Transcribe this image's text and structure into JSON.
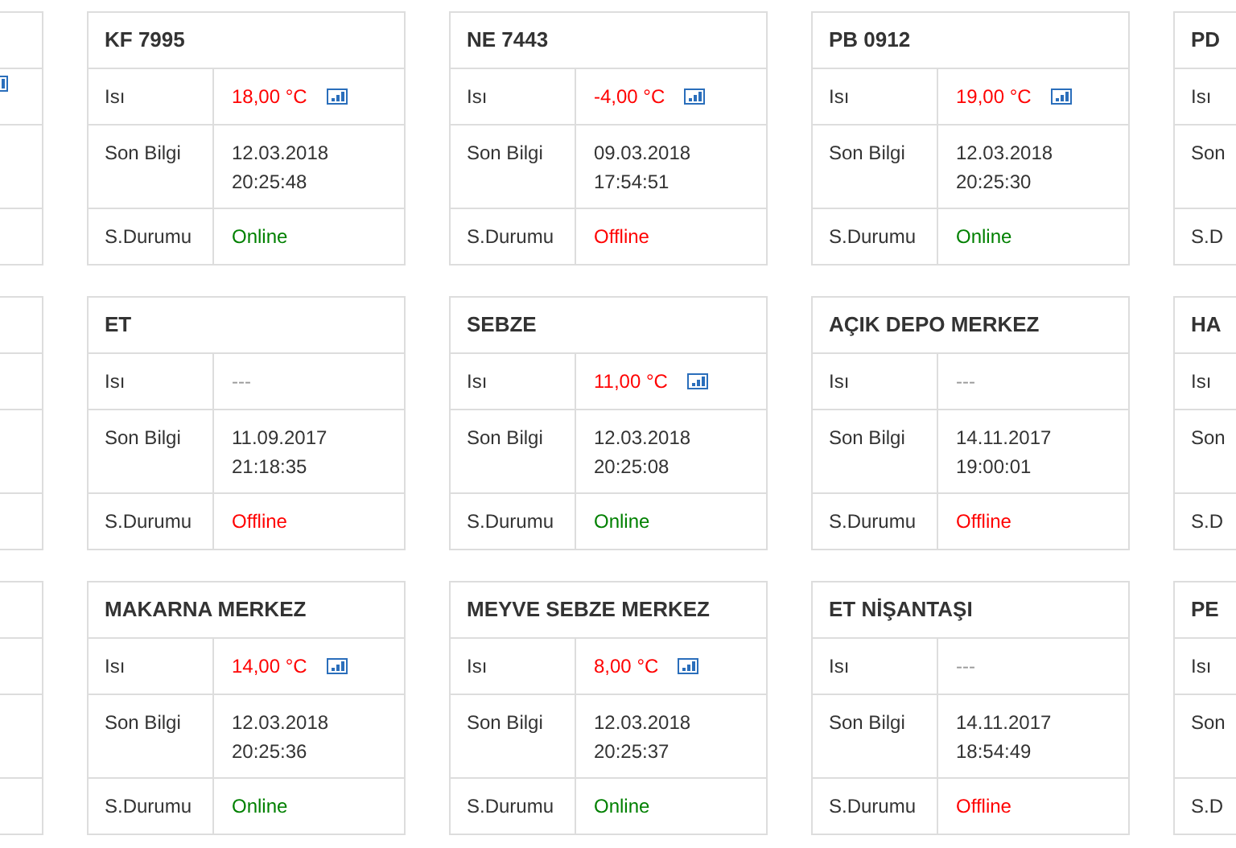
{
  "rows": [
    {
      "cards": [
        {
          "kind": "clipped_left",
          "chart_icon": true
        },
        {
          "kind": "full",
          "title": "KF 7995",
          "fields": [
            {
              "label": "Isı",
              "lines": [
                "18,00 °C"
              ],
              "color": "#ff0000",
              "chart_icon": true
            },
            {
              "label": "Son Bilgi",
              "lines": [
                "12.03.2018",
                "20:25:48"
              ],
              "color": "#333333"
            },
            {
              "label": "S.Durumu",
              "lines": [
                "Online"
              ],
              "color": "#008000"
            }
          ]
        },
        {
          "kind": "full",
          "title": "NE 7443",
          "fields": [
            {
              "label": "Isı",
              "lines": [
                "-4,00 °C"
              ],
              "color": "#ff0000",
              "chart_icon": true
            },
            {
              "label": "Son Bilgi",
              "lines": [
                "09.03.2018",
                "17:54:51"
              ],
              "color": "#333333"
            },
            {
              "label": "S.Durumu",
              "lines": [
                "Offline"
              ],
              "color": "#ff0000"
            }
          ]
        },
        {
          "kind": "full",
          "title": "PB 0912",
          "fields": [
            {
              "label": "Isı",
              "lines": [
                "19,00 °C"
              ],
              "color": "#ff0000",
              "chart_icon": true
            },
            {
              "label": "Son Bilgi",
              "lines": [
                "12.03.2018",
                "20:25:30"
              ],
              "color": "#333333"
            },
            {
              "label": "S.Durumu",
              "lines": [
                "Online"
              ],
              "color": "#008000"
            }
          ]
        },
        {
          "kind": "clipped_right",
          "title": "PD",
          "labels": [
            "Isı",
            "Son",
            "S.D"
          ]
        }
      ]
    },
    {
      "cards": [
        {
          "kind": "clipped_left",
          "chart_icon": false
        },
        {
          "kind": "full",
          "title": "ET",
          "fields": [
            {
              "label": "Isı",
              "lines": [
                "---"
              ],
              "color": "#999999",
              "chart_icon": false
            },
            {
              "label": "Son Bilgi",
              "lines": [
                "11.09.2017",
                "21:18:35"
              ],
              "color": "#333333"
            },
            {
              "label": "S.Durumu",
              "lines": [
                "Offline"
              ],
              "color": "#ff0000"
            }
          ]
        },
        {
          "kind": "full",
          "title": "SEBZE",
          "fields": [
            {
              "label": "Isı",
              "lines": [
                "11,00 °C"
              ],
              "color": "#ff0000",
              "chart_icon": true
            },
            {
              "label": "Son Bilgi",
              "lines": [
                "12.03.2018",
                "20:25:08"
              ],
              "color": "#333333"
            },
            {
              "label": "S.Durumu",
              "lines": [
                "Online"
              ],
              "color": "#008000"
            }
          ]
        },
        {
          "kind": "full",
          "title": "AÇIK DEPO MERKEZ",
          "fields": [
            {
              "label": "Isı",
              "lines": [
                "---"
              ],
              "color": "#999999",
              "chart_icon": false
            },
            {
              "label": "Son Bilgi",
              "lines": [
                "14.11.2017",
                "19:00:01"
              ],
              "color": "#333333"
            },
            {
              "label": "S.Durumu",
              "lines": [
                "Offline"
              ],
              "color": "#ff0000"
            }
          ]
        },
        {
          "kind": "clipped_right",
          "title": "HA",
          "labels": [
            "Isı",
            "Son",
            "S.D"
          ]
        }
      ]
    },
    {
      "cards": [
        {
          "kind": "clipped_left",
          "chart_icon": false
        },
        {
          "kind": "full",
          "title": "MAKARNA MERKEZ",
          "fields": [
            {
              "label": "Isı",
              "lines": [
                "14,00 °C"
              ],
              "color": "#ff0000",
              "chart_icon": true
            },
            {
              "label": "Son Bilgi",
              "lines": [
                "12.03.2018",
                "20:25:36"
              ],
              "color": "#333333"
            },
            {
              "label": "S.Durumu",
              "lines": [
                "Online"
              ],
              "color": "#008000"
            }
          ]
        },
        {
          "kind": "full",
          "title": "MEYVE SEBZE MERKEZ",
          "fields": [
            {
              "label": "Isı",
              "lines": [
                "8,00 °C"
              ],
              "color": "#ff0000",
              "chart_icon": true
            },
            {
              "label": "Son Bilgi",
              "lines": [
                "12.03.2018",
                "20:25:37"
              ],
              "color": "#333333"
            },
            {
              "label": "S.Durumu",
              "lines": [
                "Online"
              ],
              "color": "#008000"
            }
          ]
        },
        {
          "kind": "full",
          "title": "ET NİŞANTAŞI",
          "fields": [
            {
              "label": "Isı",
              "lines": [
                "---"
              ],
              "color": "#999999",
              "chart_icon": false
            },
            {
              "label": "Son Bilgi",
              "lines": [
                "14.11.2017",
                "18:54:49"
              ],
              "color": "#333333"
            },
            {
              "label": "S.Durumu",
              "lines": [
                "Offline"
              ],
              "color": "#ff0000"
            }
          ]
        },
        {
          "kind": "clipped_right",
          "title": "PE",
          "labels": [
            "Isı",
            "Son",
            "S.D"
          ]
        }
      ]
    }
  ]
}
